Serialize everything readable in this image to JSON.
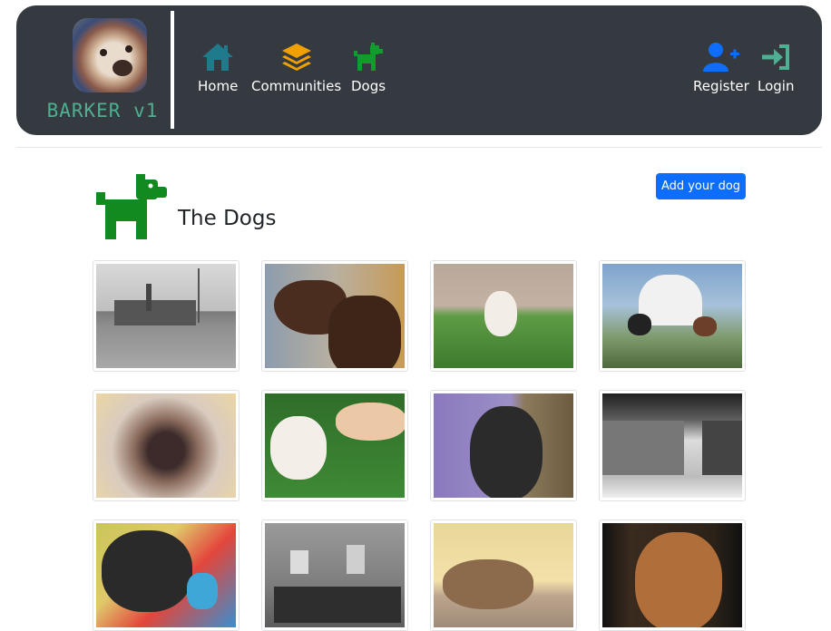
{
  "brand": {
    "name": "BARKER v1"
  },
  "nav": {
    "home": "Home",
    "communities": "Communities",
    "dogs": "Dogs",
    "register": "Register",
    "login": "Login"
  },
  "page": {
    "title": "The Dogs",
    "add_button": "Add your dog"
  },
  "gallery": {
    "items": [
      {
        "icon": "historic-town-photo"
      },
      {
        "icon": "brown-pointer-dog-photo"
      },
      {
        "icon": "white-dog-on-grass-photo"
      },
      {
        "icon": "dogs-by-gazebo-photo"
      },
      {
        "icon": "spaniel-painting-photo"
      },
      {
        "icon": "dog-and-cat-on-grass-photo"
      },
      {
        "icon": "black-doodle-dog-photo"
      },
      {
        "icon": "village-street-photo"
      },
      {
        "icon": "black-dog-on-blanket-photo"
      },
      {
        "icon": "historic-building-group-photo"
      },
      {
        "icon": "pug-dog-rolling-photo"
      },
      {
        "icon": "dog-portrait-photo"
      }
    ]
  },
  "colors": {
    "navbar": "#343a40",
    "brand_text": "#4fae93",
    "home_icon": "#1f7a8c",
    "communities_icon": "#f0a000",
    "dogs_icon": "#119c2e",
    "register_icon": "#0d6efd",
    "login_icon": "#4fae93",
    "title_dog_icon": "#138a1f",
    "button": "#0d6efd"
  }
}
